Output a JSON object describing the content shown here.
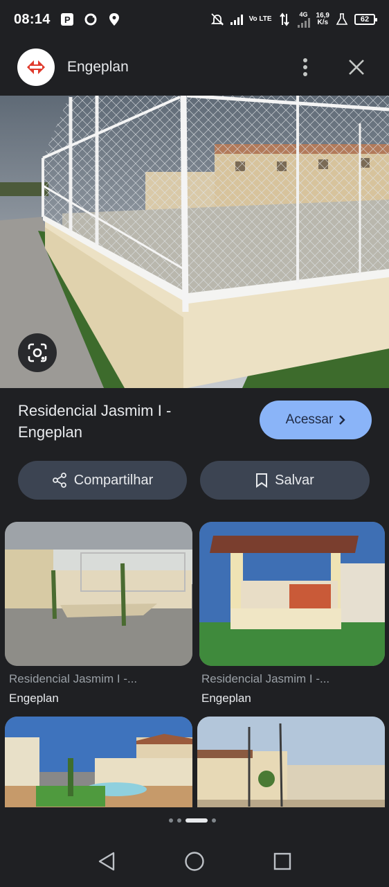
{
  "status_bar": {
    "time": "08:14",
    "net_type": "4G",
    "volte": "Vo LTE",
    "speed_value": "16,9",
    "speed_unit": "K/s",
    "battery": "62"
  },
  "app_bar": {
    "site_name": "Engeplan",
    "logo_icon": "engeplan-logo",
    "more_icon": "more-vert-icon",
    "close_icon": "close-icon"
  },
  "main": {
    "title": "Residencial Jasmim I - Engeplan",
    "visit_label": "Acessar",
    "share_label": "Compartilhar",
    "save_label": "Salvar",
    "lens_icon": "lens-icon"
  },
  "related": [
    {
      "caption": "Residencial Jasmim I -...",
      "source": "Engeplan"
    },
    {
      "caption": "Residencial Jasmim I -...",
      "source": "Engeplan"
    },
    {
      "caption": "",
      "source": ""
    },
    {
      "caption": "",
      "source": ""
    }
  ],
  "pager": {
    "count": 4,
    "active_index": 2
  },
  "colors": {
    "background": "#1f2023",
    "accent": "#8ab4f8",
    "pill": "#3c4452"
  }
}
